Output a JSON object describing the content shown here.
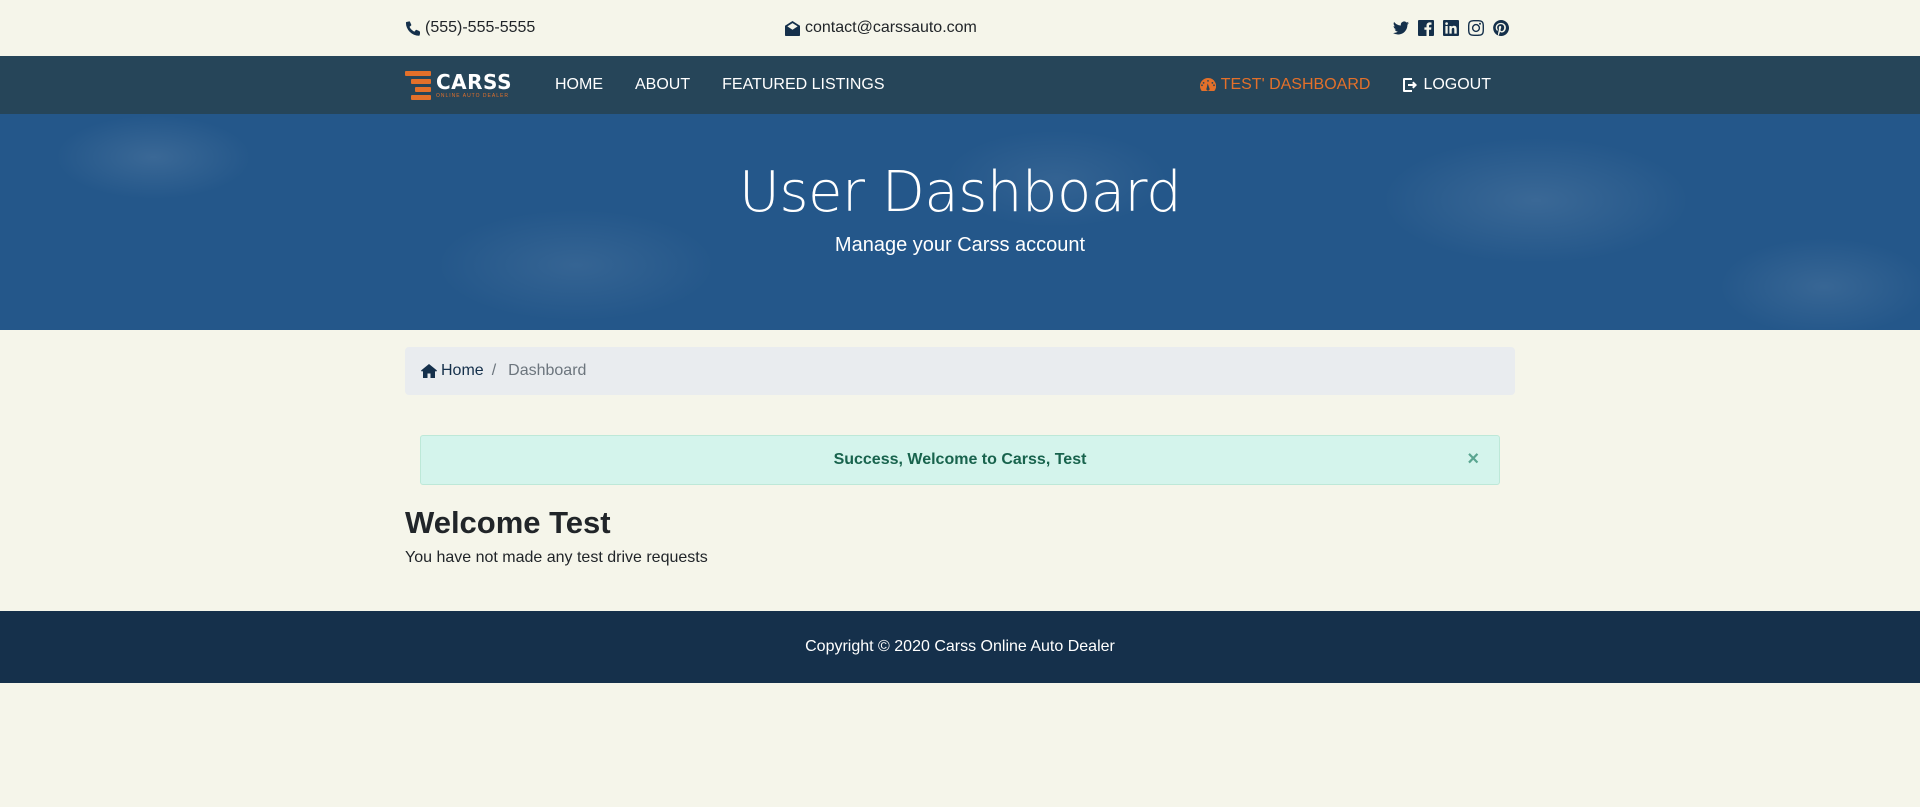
{
  "topbar": {
    "phone": "(555)-555-5555",
    "email": "contact@carssauto.com",
    "social_icons": [
      "twitter-icon",
      "facebook-icon",
      "linkedin-icon",
      "instagram-icon",
      "pinterest-icon"
    ]
  },
  "navbar": {
    "logo_text": "CARSS",
    "logo_subtext": "ONLINE AUTO DEALER",
    "links": [
      "HOME",
      "ABOUT",
      "FEATURED LISTINGS"
    ],
    "dashboard_label": "TEST' DASHBOARD",
    "logout_label": "LOGOUT"
  },
  "hero": {
    "title": "User Dashboard",
    "subtitle": "Manage your Carss account"
  },
  "breadcrumb": {
    "home": "Home",
    "separator": "/",
    "current": "Dashboard"
  },
  "alert": {
    "message": "Success, Welcome to Carss, Test",
    "close": "×"
  },
  "main": {
    "welcome": "Welcome Test",
    "no_requests": "You have not made any test drive requests"
  },
  "footer": {
    "copyright": "Copyright © 2020 Carss Online Auto Dealer"
  },
  "colors": {
    "page_bg": "#f5f5ea",
    "navbar_bg": "#264559",
    "hero_bg": "#24578a",
    "accent": "#e3702a",
    "footer_bg": "#15304b",
    "alert_bg": "#d4f4ec"
  }
}
